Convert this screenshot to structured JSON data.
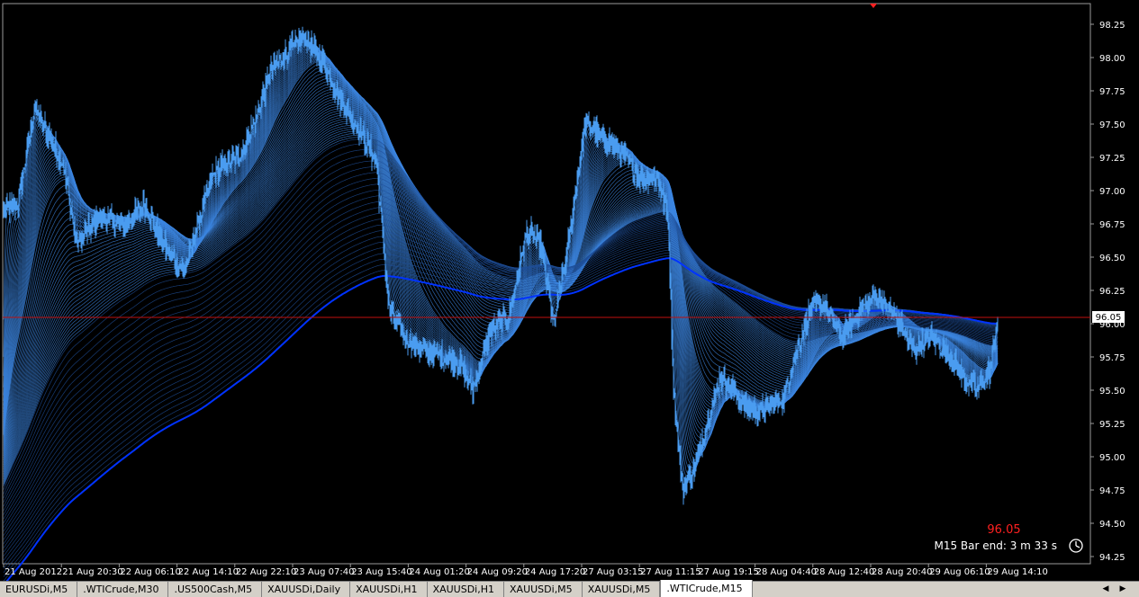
{
  "chart": {
    "symbol": ".WTICrude,M15",
    "colors": {
      "background": "#000000",
      "candle": "#4a9cf0",
      "ribbon": "#3c86e0",
      "ribbon_dark": "#1f4f9a",
      "base_line": "#0033ff",
      "price_line": "#c0100e",
      "axis_text": "#ffffff",
      "timer_price": "#ff2020"
    },
    "y_ticks": [
      "98.25",
      "98.00",
      "97.75",
      "97.50",
      "97.25",
      "97.00",
      "96.75",
      "96.50",
      "96.25",
      "96.00",
      "95.75",
      "95.50",
      "95.25",
      "95.00",
      "94.75",
      "94.50",
      "94.25"
    ],
    "x_ticks": [
      "21 Aug 2012",
      "21 Aug 20:30",
      "22 Aug 06:10",
      "22 Aug 14:10",
      "22 Aug 22:10",
      "23 Aug 07:40",
      "23 Aug 15:40",
      "24 Aug 01:20",
      "24 Aug 09:20",
      "24 Aug 17:20",
      "27 Aug 03:15",
      "27 Aug 11:15",
      "27 Aug 19:15",
      "28 Aug 04:40",
      "28 Aug 12:40",
      "28 Aug 20:40",
      "29 Aug 06:10",
      "29 Aug 14:10"
    ],
    "current_price": "96.05",
    "timer": {
      "price": "96.05",
      "label": "M15 Bar end: 3 m 33 s",
      "icon": "clock-icon"
    },
    "top_marker_icon": "triangle-down-icon"
  },
  "tabs": [
    {
      "label": "EURUSDi,M5"
    },
    {
      "label": ".WTICrude,M30"
    },
    {
      "label": ".US500Cash,M5"
    },
    {
      "label": "XAUUSDi,Daily"
    },
    {
      "label": "XAUUSDi,H1"
    },
    {
      "label": "XAUUSDi,H1"
    },
    {
      "label": "XAUUSDi,M5"
    },
    {
      "label": "XAUUSDi,M5"
    },
    {
      "label": ".WTICrude,M15"
    }
  ],
  "active_tab": 8,
  "tab_nav": {
    "left_icon": "arrow-left-icon",
    "right_icon": "arrow-right-icon"
  }
}
